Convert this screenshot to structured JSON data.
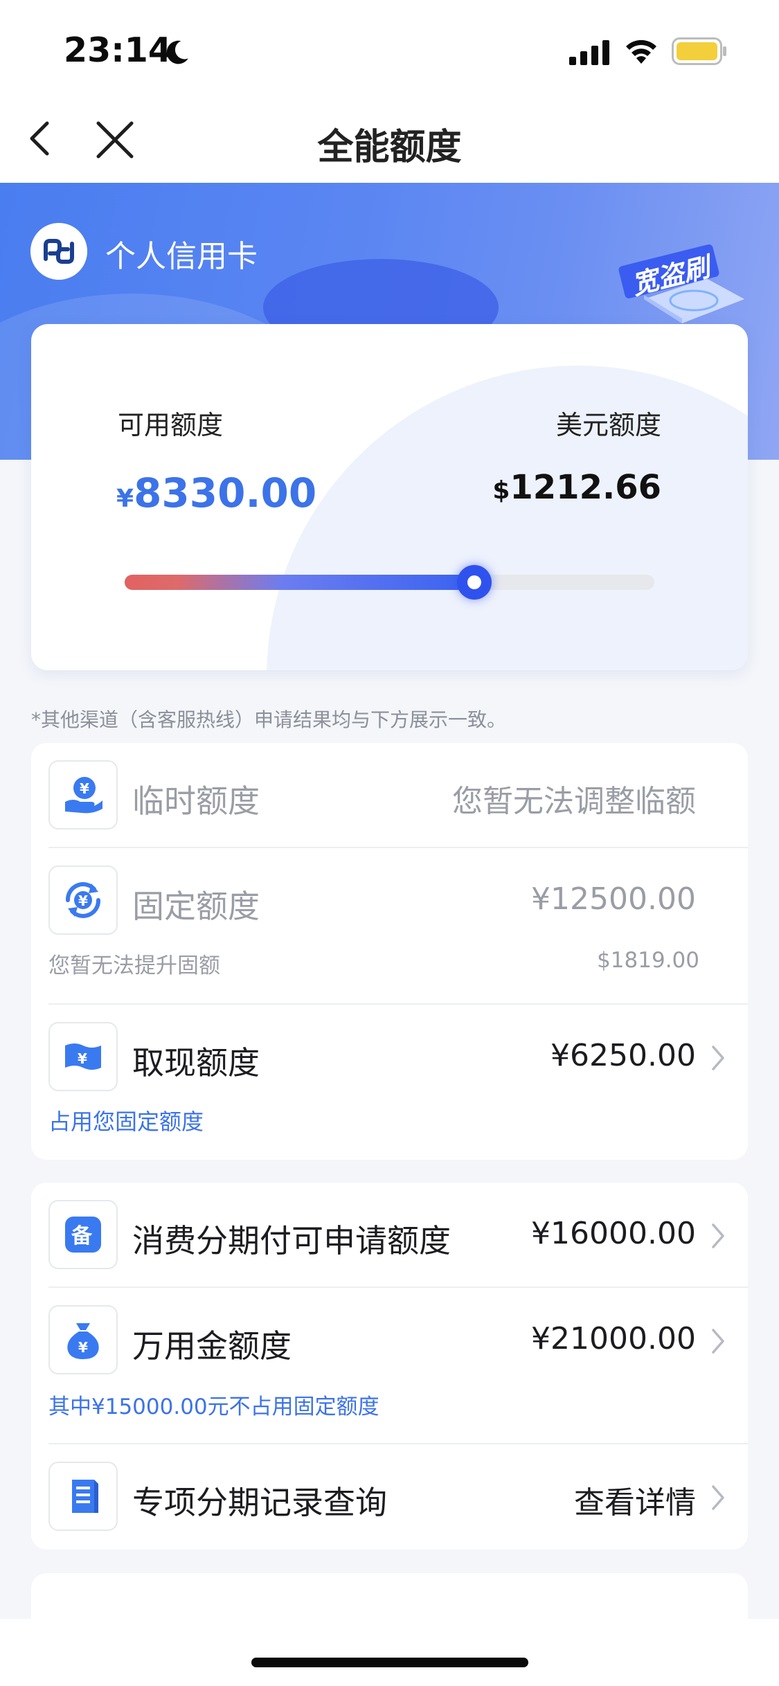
{
  "status_bar": {
    "time": "23:14"
  },
  "nav": {
    "title": "全能额度"
  },
  "card": {
    "type": "个人信用卡",
    "badge_text": "宽盗刷",
    "available_label": "可用额度",
    "available_currency": "¥",
    "available_amount": "8330.00",
    "usd_label": "美元额度",
    "usd_currency": "$",
    "usd_amount": "1212.66",
    "slider_level_percent": 66
  },
  "notice": "*其他渠道（含客服热线）申请结果均与下方展示一致。",
  "limits": {
    "temporary": {
      "label": "临时额度",
      "value": "您暂无法调整临额"
    },
    "fixed": {
      "label": "固定额度",
      "value": "¥12500.00",
      "sub_left": "您暂无法提升固额",
      "sub_right": "$1819.00"
    },
    "cash": {
      "label": "取现额度",
      "value": "¥6250.00",
      "sub": "占用您固定额度"
    }
  },
  "installments": {
    "consumption": {
      "label": "消费分期付可申请额度",
      "value": "¥16000.00"
    },
    "wanyongjin": {
      "label": "万用金额度",
      "value": "¥21000.00",
      "sub": "其中¥15000.00元不占用固定额度"
    },
    "special": {
      "label": "专项分期记录查询",
      "value": "查看详情"
    }
  },
  "colors": {
    "accent": "#3c73e8",
    "hero_blue": "#4a7df0",
    "slider_thumb": "#2f52ee"
  }
}
